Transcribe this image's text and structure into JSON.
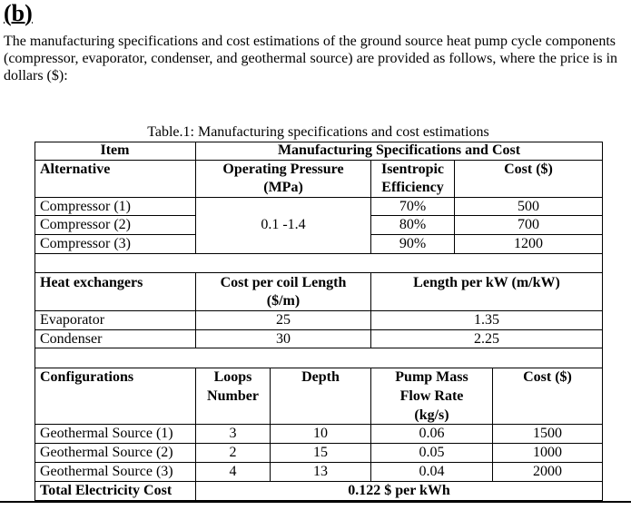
{
  "heading": "(b)",
  "intro": "The manufacturing specifications and cost estimations of the ground source heat pump cycle components (compressor, evaporator, condenser, and geothermal source) are provided as follows, where the price is in dollars ($):",
  "table": {
    "caption": "Table.1: Manufacturing specifications and cost estimations",
    "header": {
      "item": "Item",
      "group": "Manufacturing Specifications and Cost"
    },
    "compressors": {
      "col_alternative": "Alternative",
      "col_pressure_1": "Operating Pressure",
      "col_pressure_2": "(MPa)",
      "col_efficiency_1": "Isentropic",
      "col_efficiency_2": "Efficiency",
      "col_cost": "Cost ($)",
      "pressure_range": "0.1 -1.4",
      "rows": [
        {
          "name": "Compressor (1)",
          "efficiency": "70%",
          "cost": "500"
        },
        {
          "name": "Compressor (2)",
          "efficiency": "80%",
          "cost": "700"
        },
        {
          "name": "Compressor (3)",
          "efficiency": "90%",
          "cost": "1200"
        }
      ]
    },
    "heat_exchangers": {
      "col_name": "Heat exchangers",
      "col_cost_1": "Cost per coil Length",
      "col_cost_2": "($/m)",
      "col_length": "Length per kW (m/kW)",
      "rows": [
        {
          "name": "Evaporator",
          "cost_per_m": "25",
          "length_per_kw": "1.35"
        },
        {
          "name": "Condenser",
          "cost_per_m": "30",
          "length_per_kw": "2.25"
        }
      ]
    },
    "geothermal": {
      "col_name": "Configurations",
      "col_loops_1": "Loops",
      "col_loops_2": "Number",
      "col_depth": "Depth",
      "col_flow_1": "Pump Mass",
      "col_flow_2": "Flow Rate",
      "col_flow_3": "(kg/s)",
      "col_cost": "Cost ($)",
      "rows": [
        {
          "name": "Geothermal Source (1)",
          "loops": "3",
          "depth": "10",
          "flow": "0.06",
          "cost": "1500"
        },
        {
          "name": "Geothermal Source (2)",
          "loops": "2",
          "depth": "15",
          "flow": "0.05",
          "cost": "1000"
        },
        {
          "name": "Geothermal Source (3)",
          "loops": "4",
          "depth": "13",
          "flow": "0.04",
          "cost": "2000"
        }
      ]
    },
    "electricity": {
      "label": "Total Electricity Cost",
      "value": "0.122 $ per kWh"
    }
  }
}
